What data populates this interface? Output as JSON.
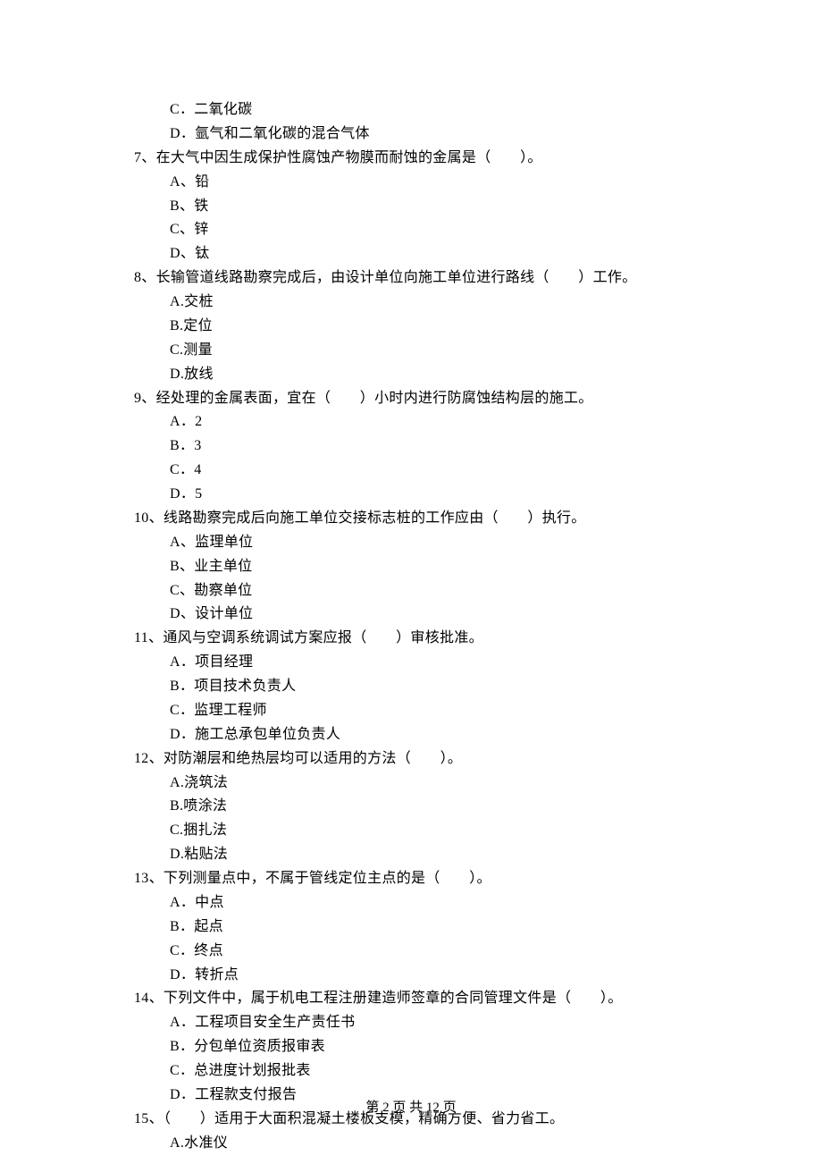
{
  "leading_options": [
    "C．二氧化碳",
    "D．氩气和二氧化碳的混合气体"
  ],
  "questions": [
    {
      "num": "7、",
      "text": "在大气中因生成保护性腐蚀产物膜而耐蚀的金属是（　　）。",
      "options": [
        "A、铅",
        "B、铁",
        "C、锌",
        "D、钛"
      ]
    },
    {
      "num": "8、",
      "text": "长输管道线路勘察完成后，由设计单位向施工单位进行路线（　　）工作。",
      "options": [
        "A.交桩",
        "B.定位",
        "C.测量",
        "D.放线"
      ]
    },
    {
      "num": "9、",
      "text": "经处理的金属表面，宜在（　　）小时内进行防腐蚀结构层的施工。",
      "options": [
        "A．2",
        "B．3",
        "C．4",
        "D．5"
      ]
    },
    {
      "num": "10、",
      "text": "线路勘察完成后向施工单位交接标志桩的工作应由（　　）执行。",
      "options": [
        "A、监理单位",
        "B、业主单位",
        "C、勘察单位",
        "D、设计单位"
      ]
    },
    {
      "num": "11、",
      "text": "通风与空调系统调试方案应报（　　）审核批准。",
      "options": [
        "A．项目经理",
        "B．项目技术负责人",
        "C．监理工程师",
        "D．施工总承包单位负责人"
      ]
    },
    {
      "num": "12、",
      "text": "对防潮层和绝热层均可以适用的方法（　　）。",
      "options": [
        "A.浇筑法",
        "B.喷涂法",
        "C.捆扎法",
        "D.粘贴法"
      ]
    },
    {
      "num": "13、",
      "text": "下列测量点中，不属于管线定位主点的是（　　）。",
      "options": [
        "A．中点",
        "B．起点",
        "C．终点",
        "D．转折点"
      ]
    },
    {
      "num": "14、",
      "text": "下列文件中，属于机电工程注册建造师签章的合同管理文件是（　　）。",
      "options": [
        "A．工程项目安全生产责任书",
        "B．分包单位资质报审表",
        "C．总进度计划报批表",
        "D．工程款支付报告"
      ]
    },
    {
      "num": "15、",
      "text": "（　　）适用于大面积混凝土楼板支模，精确方便、省力省工。",
      "options": [
        "A.水准仪"
      ]
    }
  ],
  "footer": "第 2 页 共 12 页"
}
